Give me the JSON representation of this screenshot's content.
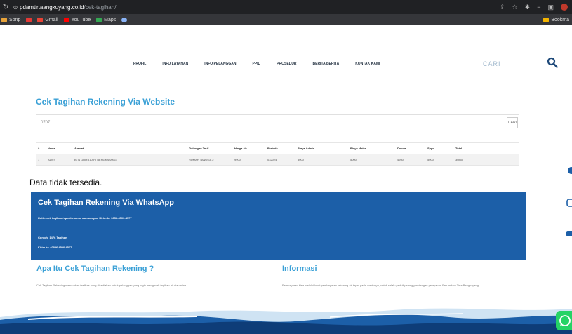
{
  "browser": {
    "url_host": "pdamtirtaangkuyang.co.id",
    "url_path": "/cek-tagihan/",
    "bookmarks": [
      {
        "label": "Sonp",
        "color": "#e8a33a"
      },
      {
        "label": "",
        "color": "#e53935"
      },
      {
        "label": "Gmail",
        "color": "#ea4335"
      },
      {
        "label": "YouTube",
        "color": "#ff0000"
      },
      {
        "label": "Maps",
        "color": "#34a853"
      },
      {
        "label": "",
        "color": "#8ab4f8"
      }
    ],
    "bookmarks_right": "Bookma"
  },
  "nav": {
    "items": [
      "PROFIL",
      "INFO LAYANAN",
      "INFO PELANGGAN",
      "PPID",
      "PROSEDUR",
      "BERITA BERITA",
      "KONTAK KAMI"
    ],
    "search_placeholder": "CARI"
  },
  "website_section": {
    "title": "Cek Tagihan Rekening Via Website",
    "input_value": "0707",
    "button_label": "CARI",
    "table": {
      "headers": [
        "#",
        "Nama",
        "Alamat",
        "Golongan Tarif",
        "Harga Air",
        "Periode",
        "Biaya Admin",
        "Biaya Meter",
        "Denda",
        "Sppd",
        "Total"
      ],
      "rows": [
        [
          "1",
          "ALVIS",
          "BTN GRIYA ASRI BENGKAYANG",
          "RUMAH TANGGA 2",
          "9900",
          "032024",
          "5000",
          "5000",
          "4950",
          "5000",
          "30850"
        ]
      ]
    },
    "no_data": "Data tidak tersedia."
  },
  "whatsapp_section": {
    "title": "Cek Tagihan Rekening Via WhatsApp",
    "line1": "Ketik: cek tagihan<spasi>nomor sambungan. Kirim ke 0856-4500-4577",
    "line2": "Contoh: 1476 Tagihan",
    "line3": "Kirim ke : 0856 4500 4577"
  },
  "apa_section": {
    "title": "Apa Itu Cek Tagihan Rekening ?",
    "text": "Cek Tagihan Rekening merupakan fasilitas yang disediakan untuk pelanggan yang ingin mengecek tagihan air via online."
  },
  "info_section": {
    "title": "Informasi",
    "text": "Pembayaran bisa melalui loket pembayaran rekening air tepat pada waktunya, untuk selalu peduli pelanggan dengan pelayanan Perumdam Tirta Bengkayang."
  },
  "colors": {
    "accent": "#3aa0d6",
    "blue_block": "#1c5fa8",
    "whatsapp": "#25d366"
  }
}
